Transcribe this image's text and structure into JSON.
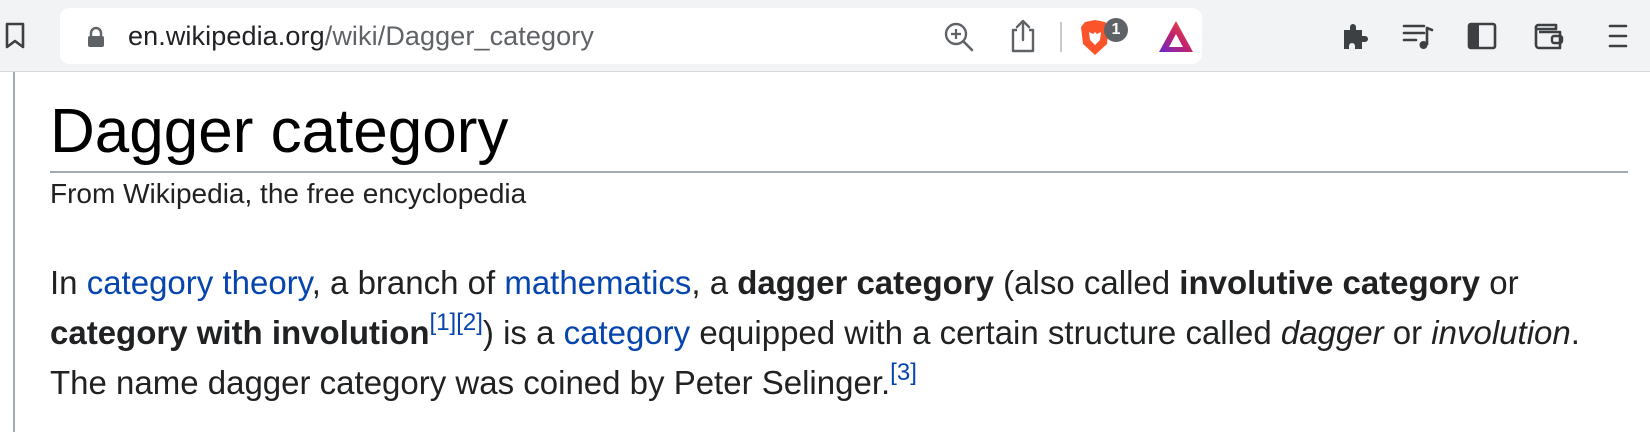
{
  "browser": {
    "url_domain": "en.wikipedia.org",
    "url_path": "/wiki/Dagger_category",
    "shields_badge_count": "1",
    "accent_brave": "#fb542b",
    "icons": [
      "bookmark-icon",
      "lock-icon",
      "zoom-icon",
      "share-icon",
      "brave-shields-icon",
      "brave-rewards-icon",
      "extensions-icon",
      "media-playlist-icon",
      "sidebar-icon",
      "wallet-icon",
      "menu-icon"
    ]
  },
  "article": {
    "title": "Dagger category",
    "tagline": "From Wikipedia, the free encyclopedia",
    "paragraph": {
      "t1": "In ",
      "link_category_theory": "category theory",
      "t2": ", a branch of ",
      "link_mathematics": "mathematics",
      "t3": ", a ",
      "b_dagger_category": "dagger category",
      "t4": " (also called ",
      "b_involutive_category": "involutive category",
      "t5": " or",
      "b_category_with_involution": "category with involution",
      "ref1": "[1]",
      "ref2": "[2]",
      "t6": ") is a ",
      "link_category": "category",
      "t7": " equipped with a certain structure called ",
      "i_dagger": "dagger",
      "t8": " or ",
      "i_involution": "involution",
      "t9": ".",
      "t10": "The name dagger category was coined by Peter Selinger.",
      "ref3": "[3]"
    },
    "link_color": "#0645ad"
  }
}
